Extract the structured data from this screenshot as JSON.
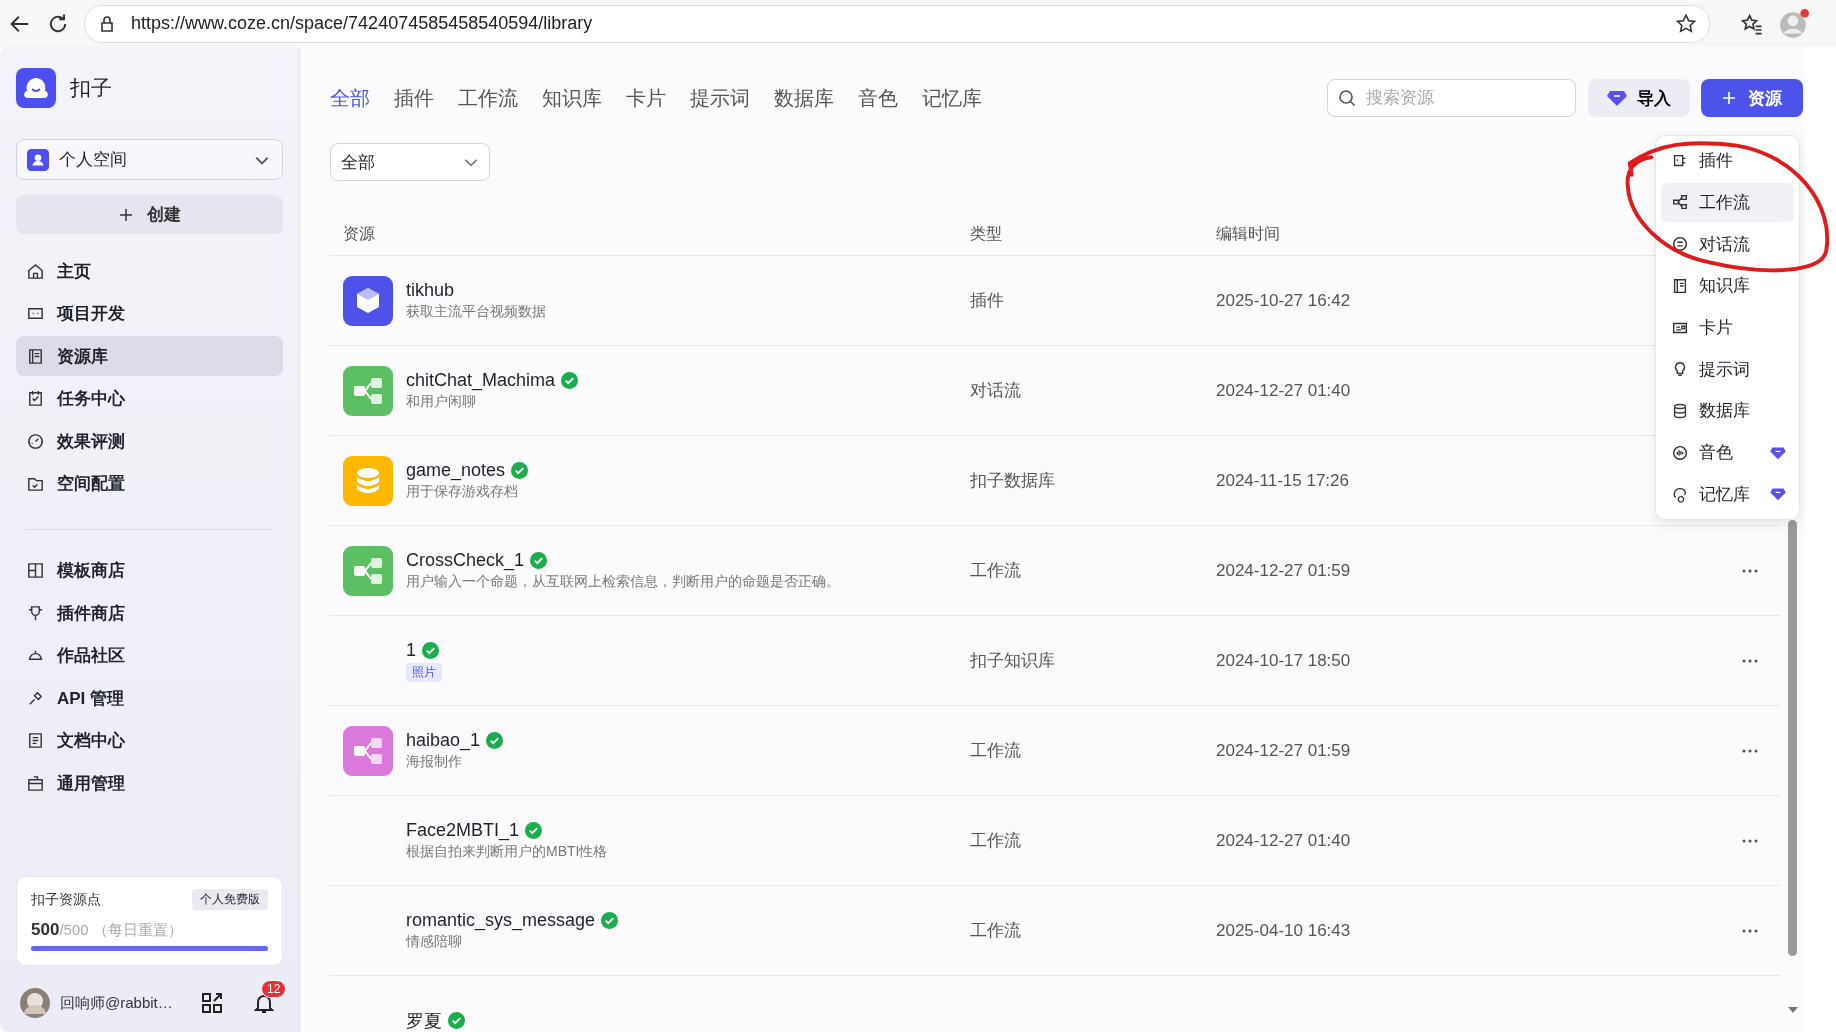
{
  "browser": {
    "url": "https://www.coze.cn/space/7424074585458540594/library"
  },
  "sidebar": {
    "brand": "扣子",
    "space": "个人空间",
    "create_button": "创建",
    "nav": [
      {
        "label": "主页",
        "selected": false
      },
      {
        "label": "项目开发",
        "selected": false
      },
      {
        "label": "资源库",
        "selected": true
      },
      {
        "label": "任务中心",
        "selected": false
      },
      {
        "label": "效果评测",
        "selected": false
      },
      {
        "label": "空间配置",
        "selected": false
      }
    ],
    "nav_secondary": [
      {
        "label": "模板商店",
        "selected": false
      },
      {
        "label": "插件商店",
        "selected": false
      },
      {
        "label": "作品社区",
        "selected": false
      },
      {
        "label": "API 管理",
        "selected": false
      },
      {
        "label": "文档中心",
        "selected": false
      },
      {
        "label": "通用管理",
        "selected": false
      }
    ],
    "points": {
      "title": "扣子资源点",
      "plan": "个人免费版",
      "used": "500",
      "total": "/500",
      "note": "（每日重置）",
      "level": 1
    },
    "user": {
      "name": "回响师@rabbit…",
      "notifications": "12"
    }
  },
  "tabs": [
    {
      "label": "全部",
      "selected": true
    },
    {
      "label": "插件",
      "selected": false
    },
    {
      "label": "工作流",
      "selected": false
    },
    {
      "label": "知识库",
      "selected": false
    },
    {
      "label": "卡片",
      "selected": false
    },
    {
      "label": "提示词",
      "selected": false
    },
    {
      "label": "数据库",
      "selected": false
    },
    {
      "label": "音色",
      "selected": false
    },
    {
      "label": "记忆库",
      "selected": false
    }
  ],
  "search": {
    "placeholder": "搜索资源"
  },
  "import_button": "导入",
  "add_button": "资源",
  "filter": {
    "value": "全部"
  },
  "table": {
    "columns": [
      "资源",
      "类型",
      "编辑时间"
    ],
    "rows": [
      {
        "name": "tikhub",
        "description": "获取主流平台视频数据",
        "type": "插件",
        "edited": "2025-10-27 16:42",
        "verified": false,
        "kind": "plugin",
        "actions": false
      },
      {
        "name": "chitChat_Machima",
        "description": "和用户闲聊",
        "type": "对话流",
        "edited": "2024-12-27 01:40",
        "verified": true,
        "kind": "workflow",
        "actions": false
      },
      {
        "name": "game_notes",
        "description": "用于保存游戏存档",
        "type": "扣子数据库",
        "edited": "2024-11-15 17:26",
        "verified": true,
        "kind": "database",
        "actions": false
      },
      {
        "name": "CrossCheck_1",
        "description": "用户输入一个命题，从互联网上检索信息，判断用户的命题是否正确。",
        "type": "工作流",
        "edited": "2024-12-27 01:59",
        "verified": true,
        "kind": "workflow",
        "actions": true
      },
      {
        "name": "1",
        "tag": "照片",
        "type": "扣子知识库",
        "edited": "2024-10-17 18:50",
        "verified": true,
        "actions": true
      },
      {
        "name": "haibao_1",
        "description": "海报制作",
        "type": "工作流",
        "edited": "2024-12-27 01:59",
        "verified": true,
        "kind": "image-workflow",
        "actions": true
      },
      {
        "name": "Face2MBTI_1",
        "description": "根据自拍来判断用户的MBTI性格",
        "type": "工作流",
        "edited": "2024-12-27 01:40",
        "verified": true,
        "actions": true
      },
      {
        "name": "romantic_sys_message",
        "description": "情感陪聊",
        "type": "工作流",
        "edited": "2025-04-10 16:43",
        "verified": true,
        "actions": true
      },
      {
        "name": "罗夏",
        "verified": true,
        "actions": false
      }
    ]
  },
  "add_menu": {
    "items": [
      {
        "label": "插件",
        "kind": "plugin",
        "selected": false,
        "premium": false
      },
      {
        "label": "工作流",
        "kind": "workflow",
        "selected": true,
        "premium": false
      },
      {
        "label": "对话流",
        "kind": "chatflow",
        "selected": false,
        "premium": false
      },
      {
        "label": "知识库",
        "kind": "knowledge",
        "selected": false,
        "premium": false
      },
      {
        "label": "卡片",
        "kind": "card",
        "selected": false,
        "premium": false
      },
      {
        "label": "提示词",
        "kind": "prompt",
        "selected": false,
        "premium": false
      },
      {
        "label": "数据库",
        "kind": "database",
        "selected": false,
        "premium": false
      },
      {
        "label": "音色",
        "kind": "voice",
        "selected": false,
        "premium": true
      },
      {
        "label": "记忆库",
        "kind": "memory",
        "selected": false,
        "premium": true
      }
    ]
  }
}
